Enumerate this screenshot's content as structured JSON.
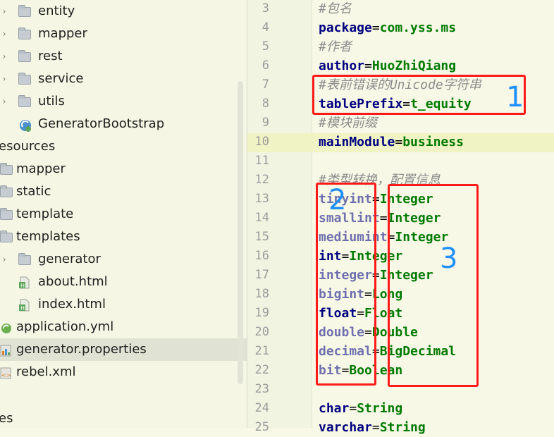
{
  "tree": {
    "items": [
      {
        "label": "entity",
        "icon": "folder-icon",
        "arrow": "›"
      },
      {
        "label": "mapper",
        "icon": "folder-icon",
        "arrow": "›"
      },
      {
        "label": "rest",
        "icon": "folder-icon",
        "arrow": "›"
      },
      {
        "label": "service",
        "icon": "folder-icon",
        "arrow": "›"
      },
      {
        "label": "utils",
        "icon": "folder-icon",
        "arrow": "›"
      },
      {
        "label": "GeneratorBootstrap",
        "icon": "spring-boot-class-icon",
        "arrow": ""
      },
      {
        "label": "esources",
        "icon": "",
        "arrow": ""
      },
      {
        "label": "mapper",
        "icon": "folder-icon",
        "arrow": ""
      },
      {
        "label": "static",
        "icon": "folder-icon",
        "arrow": ""
      },
      {
        "label": "template",
        "icon": "folder-icon",
        "arrow": ""
      },
      {
        "label": "templates",
        "icon": "folder-icon",
        "arrow": ""
      },
      {
        "label": "generator",
        "icon": "folder-icon",
        "arrow": "›"
      },
      {
        "label": "about.html",
        "icon": "html-file-icon",
        "arrow": ""
      },
      {
        "label": "index.html",
        "icon": "html-file-icon",
        "arrow": ""
      },
      {
        "label": "application.yml",
        "icon": "yaml-file-icon",
        "arrow": ""
      },
      {
        "label": "generator.properties",
        "icon": "properties-file-icon",
        "arrow": ""
      },
      {
        "label": "rebel.xml",
        "icon": "xml-file-icon",
        "arrow": ""
      },
      {
        "label": "es",
        "icon": "",
        "arrow": ""
      }
    ],
    "selected_index": 15
  },
  "editor": {
    "current_line": "10",
    "lines": [
      {
        "n": "3",
        "type": "comment",
        "text": "#包名"
      },
      {
        "n": "4",
        "type": "kv",
        "key": "package",
        "value": "com.yss.ms"
      },
      {
        "n": "5",
        "type": "comment",
        "text": "#作者"
      },
      {
        "n": "6",
        "type": "kv",
        "key": "author",
        "value": "HuoZhiQiang"
      },
      {
        "n": "7",
        "type": "comment",
        "text": "#表前错误的Unicode字符串"
      },
      {
        "n": "8",
        "type": "kv",
        "key": "tablePrefix",
        "value": "t_equity"
      },
      {
        "n": "9",
        "type": "comment",
        "text": "#模块前缀"
      },
      {
        "n": "10",
        "type": "kv",
        "key": "mainModule",
        "value": "business"
      },
      {
        "n": "11",
        "type": "blank"
      },
      {
        "n": "12",
        "type": "comment",
        "text": "#类型转换，配置信息"
      },
      {
        "n": "13",
        "type": "kv",
        "key": "tinyint",
        "value": "Integer",
        "faded": true
      },
      {
        "n": "14",
        "type": "kv",
        "key": "smallint",
        "value": "Integer",
        "faded": true
      },
      {
        "n": "15",
        "type": "kv",
        "key": "mediumint",
        "value": "Integer",
        "faded": true
      },
      {
        "n": "16",
        "type": "kv",
        "key": "int",
        "value": "Integer",
        "faded": false
      },
      {
        "n": "17",
        "type": "kv",
        "key": "integer",
        "value": "Integer",
        "faded": true
      },
      {
        "n": "18",
        "type": "kv",
        "key": "bigint",
        "value": "Long",
        "faded": true
      },
      {
        "n": "19",
        "type": "kv",
        "key": "float",
        "value": "Float",
        "faded": false
      },
      {
        "n": "20",
        "type": "kv",
        "key": "double",
        "value": "Double",
        "faded": true
      },
      {
        "n": "21",
        "type": "kv",
        "key": "decimal",
        "value": "BigDecimal",
        "faded": true
      },
      {
        "n": "22",
        "type": "kv",
        "key": "bit",
        "value": "Boolean",
        "faded": true
      },
      {
        "n": "23",
        "type": "blank"
      },
      {
        "n": "24",
        "type": "kv",
        "key": "char",
        "value": "String"
      },
      {
        "n": "25",
        "type": "kv",
        "key": "varchar",
        "value": "String"
      }
    ]
  },
  "annotations": {
    "labels": [
      "1",
      "2",
      "3"
    ],
    "color": "#ff1a1a",
    "label_color": "#1e90ff"
  }
}
